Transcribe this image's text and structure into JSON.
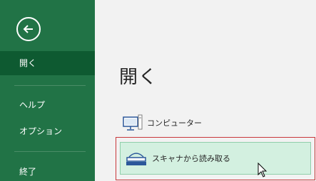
{
  "sidebar": {
    "back_label": "",
    "items": [
      {
        "label": "開く",
        "selected": true
      },
      {
        "label": "ヘルプ",
        "selected": false
      },
      {
        "label": "オプション",
        "selected": false
      },
      {
        "label": "終了",
        "selected": false
      }
    ]
  },
  "main": {
    "title": "開く",
    "locations": [
      {
        "label": "コンピューター",
        "icon": "computer-icon"
      },
      {
        "label": "スキャナから読み取る",
        "icon": "scanner-icon",
        "highlighted": true
      }
    ]
  },
  "colors": {
    "sidebar_bg": "#217346",
    "sidebar_selected": "#0e5a31",
    "highlight_bg": "#d3f0e0",
    "highlight_border": "#c8363a"
  }
}
